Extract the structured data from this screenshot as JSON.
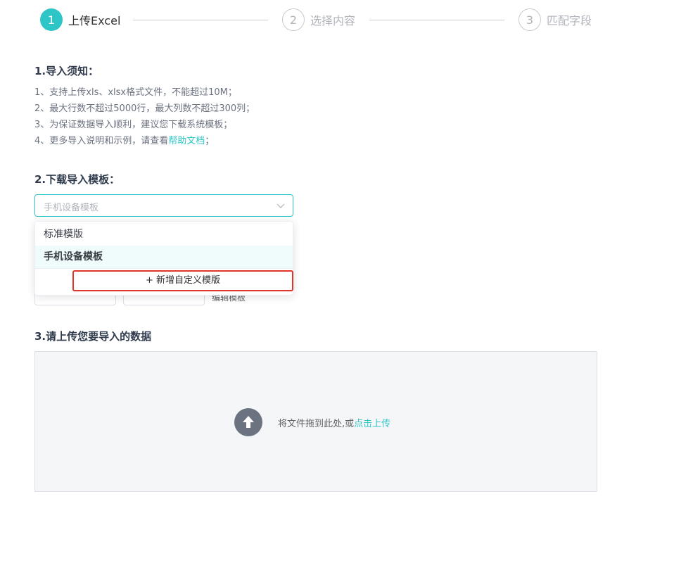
{
  "steps": [
    {
      "number": "1",
      "label": "上传Excel"
    },
    {
      "number": "2",
      "label": "选择内容"
    },
    {
      "number": "3",
      "label": "匹配字段"
    }
  ],
  "section1": {
    "title": "1.导入须知：",
    "lines": [
      "1、支持上传xls、xlsx格式文件，不能超过10M；",
      "2、最大行数不超过5000行，最大列数不超过300列；",
      "3、为保证数据导入顺利，建议您下载系统模板；"
    ],
    "line4_prefix": "4、更多导入说明和示例，请查看",
    "help_link": "帮助文档",
    "line4_suffix": "；"
  },
  "section2": {
    "title": "2.下载导入模板：",
    "select_placeholder": "手机设备模板",
    "options": [
      "标准模版",
      "手机设备模板"
    ],
    "add_custom": "+ 新增自定义模版",
    "edit_template": "编辑模板"
  },
  "section3": {
    "title": "3.请上传您要导入的数据",
    "drop_text": "将文件拖到此处,或",
    "upload_link": "点击上传"
  },
  "colors": {
    "accent": "#2ec5c7",
    "highlight_border": "#e0352b"
  }
}
